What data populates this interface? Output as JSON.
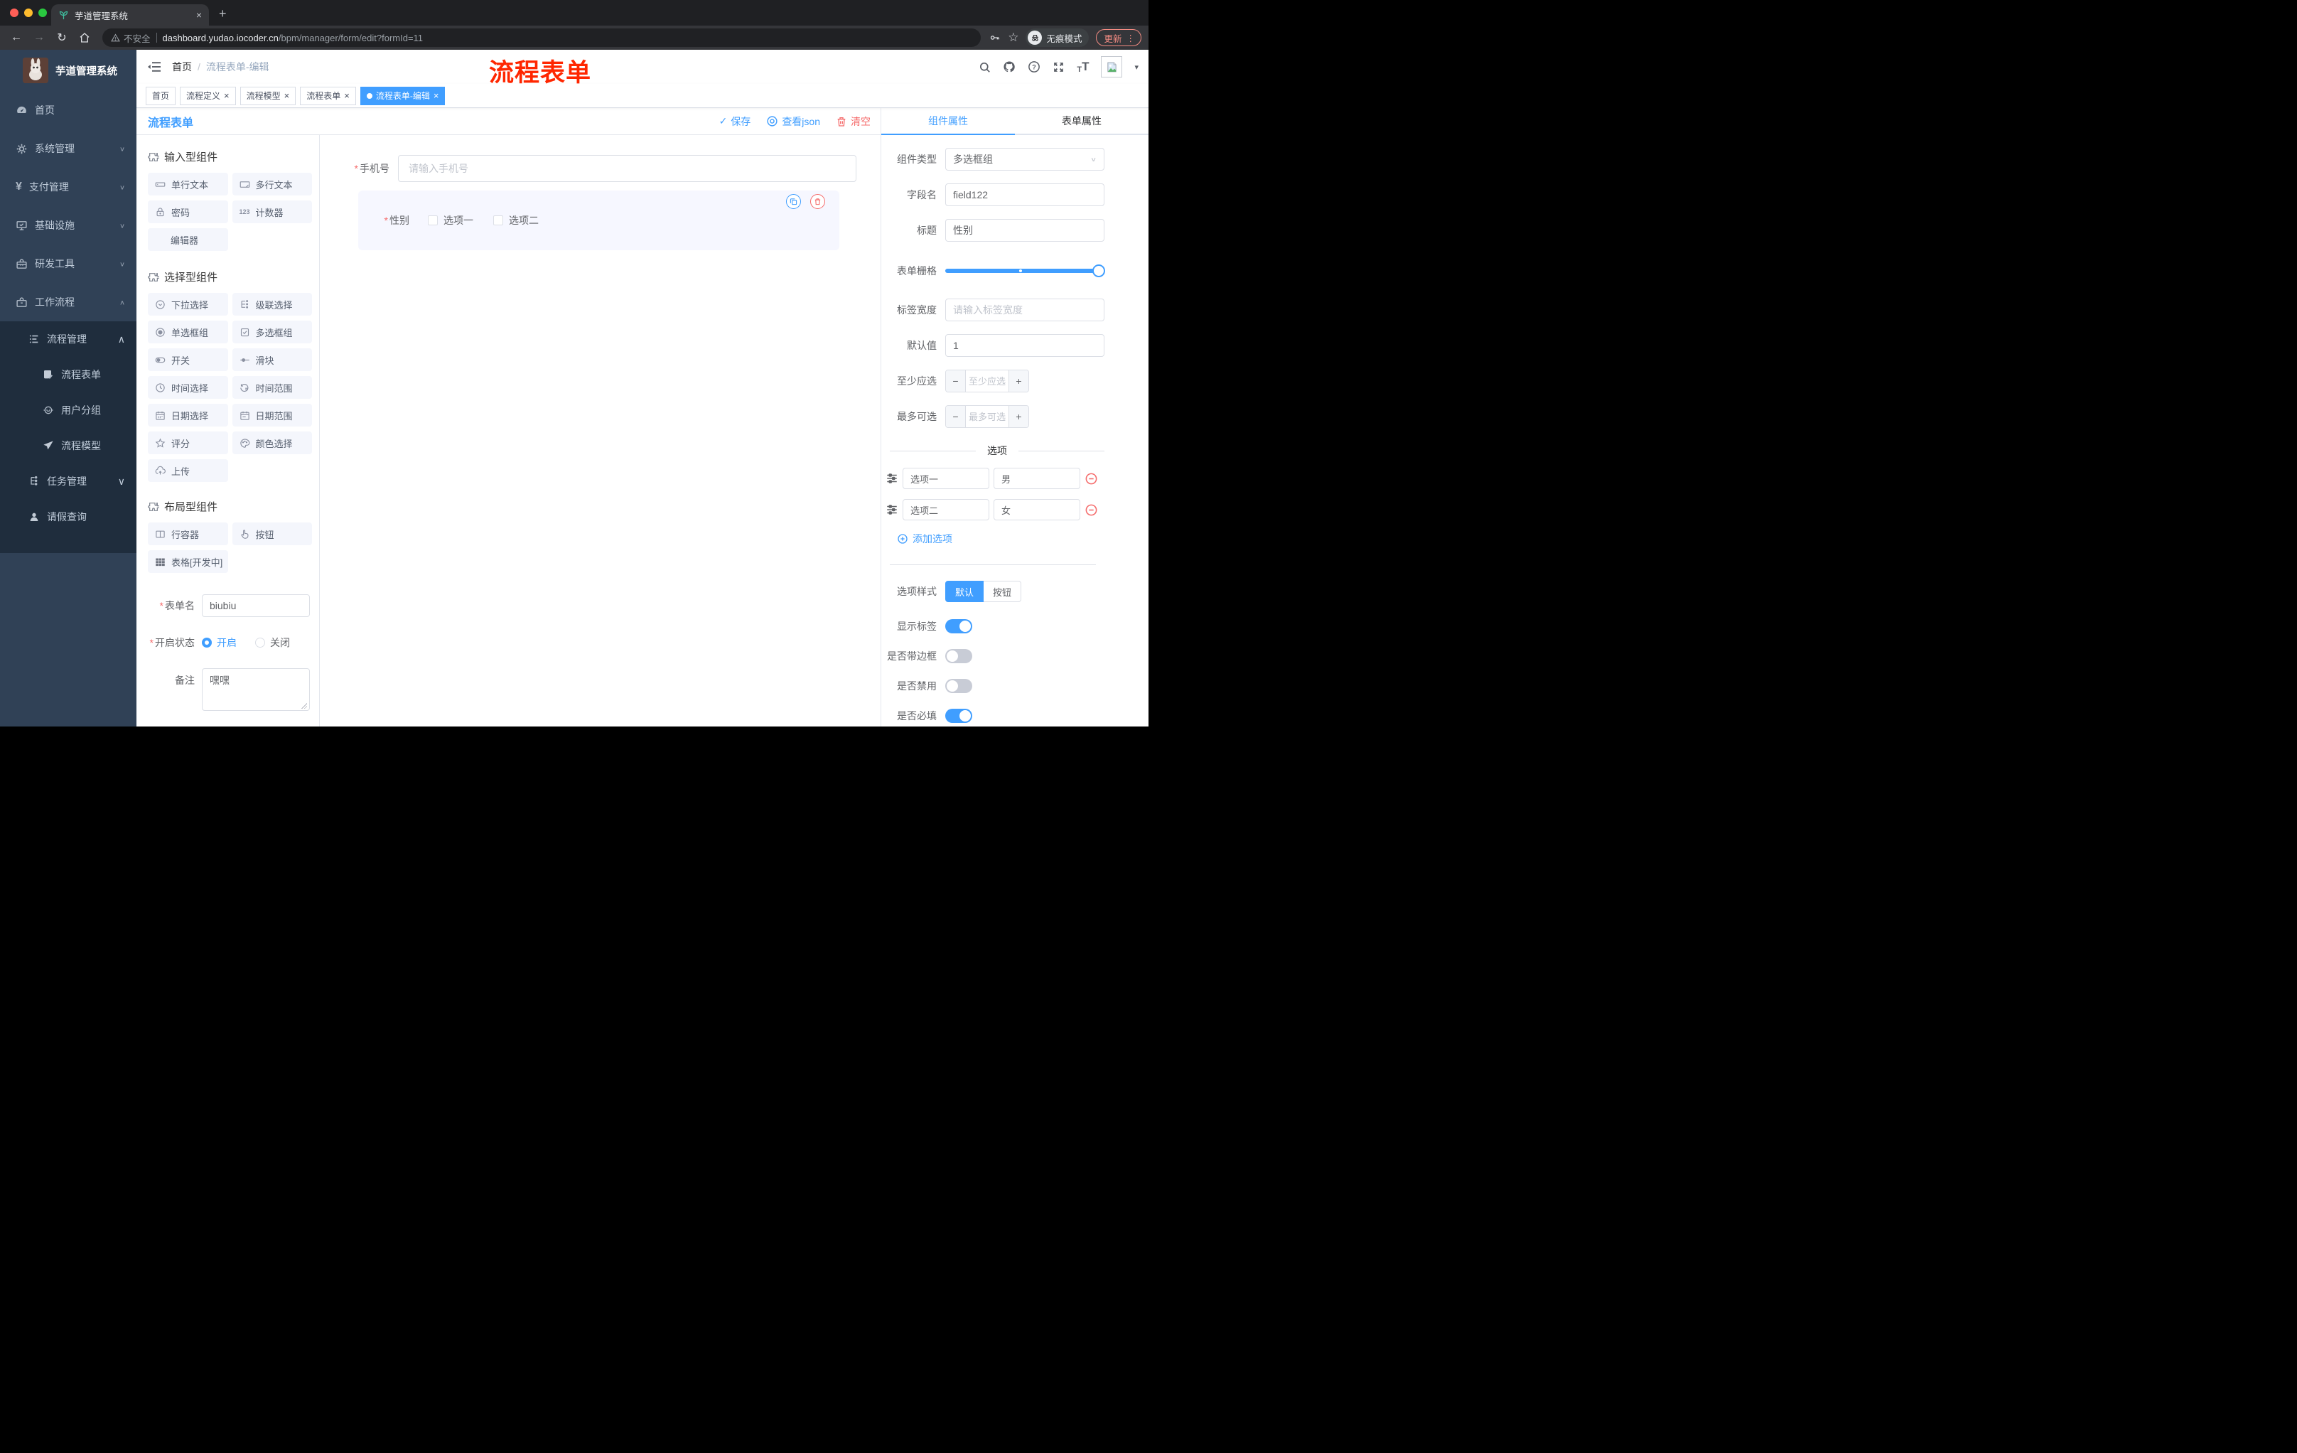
{
  "browser": {
    "tab_title": "芋道管理系统",
    "security_label": "不安全",
    "url_domain": "dashboard.yudao.iocoder.cn",
    "url_path": "/bpm/manager/form/edit?formId=11",
    "incognito_label": "无痕模式",
    "update_label": "更新"
  },
  "icons": {
    "close": "×",
    "new_tab": "+",
    "more_vertical": "⋮",
    "caret_down": "▾",
    "back_arrow": "←",
    "forward_arrow": "→",
    "reload": "↻",
    "star": "☆",
    "check": "✓",
    "question_mark": "?",
    "minus": "−",
    "plus": "+",
    "active_dot": "",
    "asterisk": "*",
    "slash": "/",
    "chevron_down": "∨",
    "chevron_up": "∧",
    "numbers": "123",
    "font_big": "T",
    "font_small": "T"
  },
  "sidebar": {
    "logo_title": "芋道管理系统",
    "items": [
      {
        "label": "首页",
        "icon": "dashboard-icon"
      },
      {
        "label": "系统管理",
        "icon": "gear-icon"
      },
      {
        "label": "支付管理",
        "icon": "payment-icon"
      },
      {
        "label": "基础设施",
        "icon": "infrastructure-icon"
      },
      {
        "label": "研发工具",
        "icon": "devtools-icon"
      },
      {
        "label": "工作流程",
        "icon": "workflow-icon"
      }
    ],
    "submenu": [
      {
        "label": "流程管理",
        "icon": "process-manage-icon"
      },
      {
        "label": "流程表单",
        "icon": "process-form-icon"
      },
      {
        "label": "用户分组",
        "icon": "user-group-icon"
      },
      {
        "label": "流程模型",
        "icon": "process-model-icon"
      },
      {
        "label": "任务管理",
        "icon": "task-manage-icon"
      },
      {
        "label": "请假查询",
        "icon": "leave-query-icon"
      }
    ]
  },
  "header": {
    "breadcrumb_home": "首页",
    "breadcrumb_current": "流程表单-编辑",
    "annotation": "流程表单"
  },
  "tags": [
    {
      "label": "首页"
    },
    {
      "label": "流程定义"
    },
    {
      "label": "流程模型"
    },
    {
      "label": "流程表单"
    },
    {
      "label": "流程表单-编辑"
    }
  ],
  "designer": {
    "title": "流程表单",
    "save_label": "保存",
    "view_json_label": "查看json",
    "clear_label": "清空"
  },
  "components": {
    "groups": [
      {
        "title": "输入型组件",
        "items": [
          {
            "label": "单行文本",
            "icon": "input-icon"
          },
          {
            "label": "多行文本",
            "icon": "textarea-icon"
          },
          {
            "label": "密码",
            "icon": "lock-icon"
          },
          {
            "label": "计数器",
            "icon": "number-icon"
          },
          {
            "label": "编辑器",
            "icon": ""
          }
        ]
      },
      {
        "title": "选择型组件",
        "items": [
          {
            "label": "下拉选择",
            "icon": "select-icon"
          },
          {
            "label": "级联选择",
            "icon": "cascader-icon"
          },
          {
            "label": "单选框组",
            "icon": "radio-icon"
          },
          {
            "label": "多选框组",
            "icon": "checkbox-icon"
          },
          {
            "label": "开关",
            "icon": "switch-icon"
          },
          {
            "label": "滑块",
            "icon": "slider-icon"
          },
          {
            "label": "时间选择",
            "icon": "time-icon"
          },
          {
            "label": "时间范围",
            "icon": "time-range-icon"
          },
          {
            "label": "日期选择",
            "icon": "date-icon"
          },
          {
            "label": "日期范围",
            "icon": "date-range-icon"
          },
          {
            "label": "评分",
            "icon": "rate-icon"
          },
          {
            "label": "颜色选择",
            "icon": "color-icon"
          },
          {
            "label": "上传",
            "icon": "upload-icon"
          }
        ]
      },
      {
        "title": "布局型组件",
        "items": [
          {
            "label": "行容器",
            "icon": "row-icon"
          },
          {
            "label": "按钮",
            "icon": "button-icon"
          },
          {
            "label": "表格[开发中]",
            "icon": "table-icon"
          }
        ]
      }
    ],
    "form": {
      "name_label": "表单名",
      "name_value": "biubiu",
      "status_label": "开启状态",
      "status_on": "开启",
      "status_off": "关闭",
      "remark_label": "备注",
      "remark_value": "嘿嘿"
    }
  },
  "canvas": {
    "phone": {
      "label": "手机号",
      "placeholder": "请输入手机号"
    },
    "gender": {
      "label": "性别",
      "option1": "选项一",
      "option2": "选项二"
    }
  },
  "props": {
    "tab_component": "组件属性",
    "tab_form": "表单属性",
    "type_label": "组件类型",
    "type_value": "多选框组",
    "field_label": "字段名",
    "field_value": "field122",
    "title_label": "标题",
    "title_value": "性别",
    "grid_label": "表单栅格",
    "label_width_label": "标签宽度",
    "label_width_placeholder": "请输入标签宽度",
    "default_label": "默认值",
    "default_value": "1",
    "min_label": "至少应选",
    "min_placeholder": "至少应选",
    "max_label": "最多可选",
    "max_placeholder": "最多可选",
    "options_title": "选项",
    "options": [
      {
        "label": "选项一",
        "value": "男"
      },
      {
        "label": "选项二",
        "value": "女"
      }
    ],
    "add_option_label": "添加选项",
    "style_label": "选项样式",
    "style_default": "默认",
    "style_button": "按钮",
    "toggle_show_label": "显示标签",
    "toggle_border_label": "是否带边框",
    "toggle_disabled_label": "是否禁用",
    "toggle_required_label": "是否必填"
  },
  "colors": {
    "accent": "#409eff",
    "danger": "#f56c6c",
    "sidebar_bg": "#304156",
    "submenu_bg": "#1f2d3d",
    "annotation": "#ff2600",
    "selected_widget_bg": "#f6f7ff"
  }
}
